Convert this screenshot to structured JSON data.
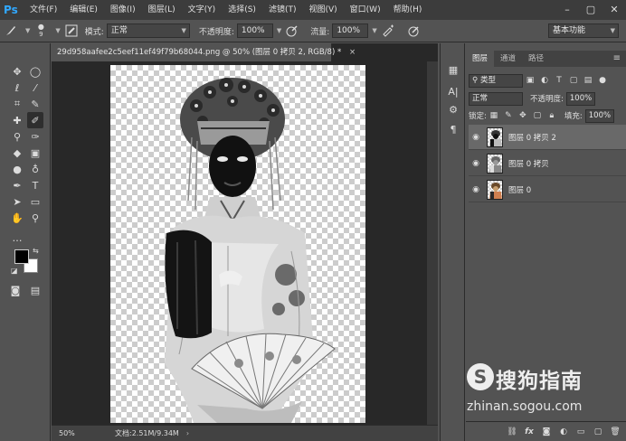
{
  "app": {
    "logo": "Ps"
  },
  "menu": [
    "文件(F)",
    "编辑(E)",
    "图像(I)",
    "图层(L)",
    "文字(Y)",
    "选择(S)",
    "滤镜(T)",
    "视图(V)",
    "窗口(W)",
    "帮助(H)"
  ],
  "window_controls": {
    "minimize": "–",
    "restore": "▢",
    "close": "✕"
  },
  "options": {
    "brush_size": "9",
    "mode_label": "模式:",
    "mode_value": "正常",
    "opacity_label": "不透明度:",
    "opacity_value": "100%",
    "flow_label": "流量:",
    "flow_value": "100%",
    "workspace": "基本功能"
  },
  "document": {
    "tab_title": "29d958aafee2c5eef11ef49f79b68044.png @ 50% (图层 0 拷贝 2, RGB/8) *",
    "close_glyph": "×"
  },
  "status": {
    "zoom": "50%",
    "doc_info": "文档:2.51M/9.34M",
    "arrow": "›"
  },
  "layers_panel": {
    "tabs": [
      "图层",
      "通道",
      "路径"
    ],
    "menu_glyph": "≡",
    "filter_label": "类型",
    "blend_mode": "正常",
    "opacity_label": "不透明度:",
    "opacity_value": "100%",
    "lock_label": "锁定:",
    "fill_label": "填充:",
    "fill_value": "100%",
    "layers": [
      {
        "name": "图层 0 拷贝 2",
        "selected": true
      },
      {
        "name": "图层 0 拷贝",
        "selected": false
      },
      {
        "name": "图层 0",
        "selected": false
      }
    ],
    "footer_icons": [
      "link-icon",
      "fx-icon",
      "mask-icon",
      "adjustment-icon",
      "folder-icon",
      "new-layer-icon",
      "trash-icon"
    ]
  },
  "colors": {
    "foreground": "#000000",
    "background": "#ffffff",
    "accent": "#31a8ff"
  },
  "watermark": {
    "logo": "S",
    "brand": "搜狗指南",
    "url": "zhinan.sogou.com"
  }
}
